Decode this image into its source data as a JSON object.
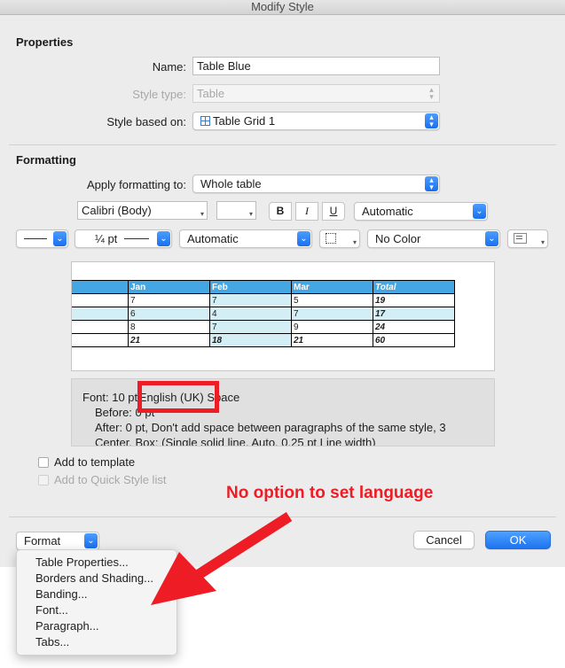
{
  "window": {
    "title": "Modify Style"
  },
  "properties": {
    "section_title": "Properties",
    "name_label": "Name:",
    "name_value": "Table Blue",
    "style_type_label": "Style type:",
    "style_type_value": "Table",
    "based_on_label": "Style based on:",
    "based_on_value": "Table Grid 1"
  },
  "formatting": {
    "section_title": "Formatting",
    "apply_label": "Apply formatting to:",
    "apply_value": "Whole table",
    "font_value": "Calibri (Body)",
    "size_value": "",
    "bold": "B",
    "italic": "I",
    "underline": "U",
    "font_color": "Automatic",
    "line_width": "¼ pt",
    "border_color": "Automatic",
    "fill_color": "No Color"
  },
  "preview": {
    "header": [
      "",
      "Jan",
      "Feb",
      "Mar",
      "Total"
    ],
    "rows": [
      [
        "",
        "7",
        "7",
        "5",
        "19"
      ],
      [
        "",
        "6",
        "4",
        "7",
        "17"
      ],
      [
        "",
        "8",
        "7",
        "9",
        "24"
      ],
      [
        "",
        "21",
        "18",
        "21",
        "60"
      ]
    ]
  },
  "description": {
    "line1_a": "Font: 10 pt",
    "line1_lang": "English (UK)",
    "line1_b": "Space",
    "line2": "Before:  0 pt",
    "line3": "After:  0 pt, Don't add space between paragraphs of the same style,  3",
    "line4": "Center, Box: (Single solid line, Auto,  0.25 pt Line width)"
  },
  "checkboxes": {
    "add_template": "Add to template",
    "add_quick": "Add to Quick Style list"
  },
  "buttons": {
    "format": "Format",
    "cancel": "Cancel",
    "ok": "OK"
  },
  "format_menu": [
    "Table Properties...",
    "Borders and Shading...",
    "Banding...",
    "Font...",
    "Paragraph...",
    "Tabs..."
  ],
  "annotation": {
    "text": "No option to set language",
    "color": "#ee1c24"
  },
  "colors": {
    "accent": "#1a6ff0",
    "table_header": "#45a6e4",
    "table_band": "#d3eef5"
  }
}
